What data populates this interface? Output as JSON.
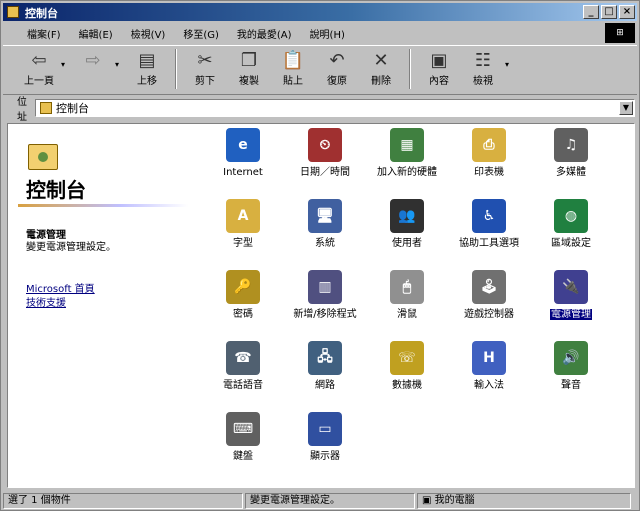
{
  "window": {
    "title": "控制台"
  },
  "menu": [
    "檔案(F)",
    "編輯(E)",
    "檢視(V)",
    "移至(G)",
    "我的最愛(A)",
    "說明(H)"
  ],
  "toolbar": [
    {
      "label": "上一頁",
      "icon": "back-icon",
      "glyph": "⇦",
      "dim": false,
      "dropdown": true
    },
    {
      "label": "",
      "icon": "forward-icon",
      "glyph": "⇨",
      "dim": true,
      "dropdown": true
    },
    {
      "label": "上移",
      "icon": "up-folder-icon",
      "glyph": "▤",
      "dim": false,
      "dropdown": false
    },
    {
      "label": "剪下",
      "icon": "cut-icon",
      "glyph": "✂",
      "dim": false,
      "dropdown": false
    },
    {
      "label": "複製",
      "icon": "copy-icon",
      "glyph": "❐",
      "dim": false,
      "dropdown": false
    },
    {
      "label": "貼上",
      "icon": "paste-icon",
      "glyph": "📋",
      "dim": false,
      "dropdown": false
    },
    {
      "label": "復原",
      "icon": "undo-icon",
      "glyph": "↶",
      "dim": false,
      "dropdown": false
    },
    {
      "label": "刪除",
      "icon": "delete-icon",
      "glyph": "✕",
      "dim": false,
      "dropdown": false
    },
    {
      "label": "內容",
      "icon": "properties-icon",
      "glyph": "▣",
      "dim": false,
      "dropdown": false
    },
    {
      "label": "檢視",
      "icon": "views-icon",
      "glyph": "☷",
      "dim": false,
      "dropdown": true
    }
  ],
  "address": {
    "label": "位址",
    "value": "控制台"
  },
  "leftpane": {
    "title": "控制台",
    "section_title": "電源管理",
    "section_desc": "變更電源管理設定。",
    "links": [
      "Microsoft 首頁",
      "技術支援"
    ]
  },
  "items": [
    {
      "label": "Internet",
      "icon": "internet-icon",
      "color": "#2060c0",
      "glyph": "e"
    },
    {
      "label": "日期／時間",
      "icon": "clock-icon",
      "color": "#a03030",
      "glyph": "⏲"
    },
    {
      "label": "加入新的硬體",
      "icon": "add-hardware-icon",
      "color": "#408040",
      "glyph": "▦"
    },
    {
      "label": "印表機",
      "icon": "printer-folder-icon",
      "color": "#d8b040",
      "glyph": "⎙"
    },
    {
      "label": "多媒體",
      "icon": "multimedia-icon",
      "color": "#606060",
      "glyph": "♫"
    },
    {
      "label": "字型",
      "icon": "fonts-folder-icon",
      "color": "#d8b040",
      "glyph": "A"
    },
    {
      "label": "系統",
      "icon": "system-icon",
      "color": "#4060a0",
      "glyph": "🖥"
    },
    {
      "label": "使用者",
      "icon": "users-icon",
      "color": "#303030",
      "glyph": "👥"
    },
    {
      "label": "協助工具選項",
      "icon": "accessibility-icon",
      "color": "#2050b0",
      "glyph": "♿"
    },
    {
      "label": "區域設定",
      "icon": "globe-icon",
      "color": "#208040",
      "glyph": "◍"
    },
    {
      "label": "密碼",
      "icon": "keys-icon",
      "color": "#b09020",
      "glyph": "🔑"
    },
    {
      "label": "新增/移除程式",
      "icon": "add-remove-programs-icon",
      "color": "#505080",
      "glyph": "▥"
    },
    {
      "label": "滑鼠",
      "icon": "mouse-icon",
      "color": "#909090",
      "glyph": "🖱"
    },
    {
      "label": "遊戲控制器",
      "icon": "joystick-icon",
      "color": "#707070",
      "glyph": "🕹"
    },
    {
      "label": "電源管理",
      "icon": "power-icon",
      "color": "#404090",
      "glyph": "🔌",
      "selected": true
    },
    {
      "label": "電話語音",
      "icon": "telephony-icon",
      "color": "#506070",
      "glyph": "☎"
    },
    {
      "label": "網路",
      "icon": "network-icon",
      "color": "#406080",
      "glyph": "🖧"
    },
    {
      "label": "數據機",
      "icon": "modem-icon",
      "color": "#c0a020",
      "glyph": "☏"
    },
    {
      "label": "輸入法",
      "icon": "input-method-icon",
      "color": "#4060c0",
      "glyph": "H"
    },
    {
      "label": "聲音",
      "icon": "sound-icon",
      "color": "#408040",
      "glyph": "🔊"
    },
    {
      "label": "鍵盤",
      "icon": "keyboard-icon",
      "color": "#606060",
      "glyph": "⌨"
    },
    {
      "label": "顯示器",
      "icon": "display-icon",
      "color": "#3050a0",
      "glyph": "▭"
    }
  ],
  "status": {
    "count": "選了 1 個物件",
    "desc": "變更電源管理設定。",
    "zone": "我的電腦"
  }
}
